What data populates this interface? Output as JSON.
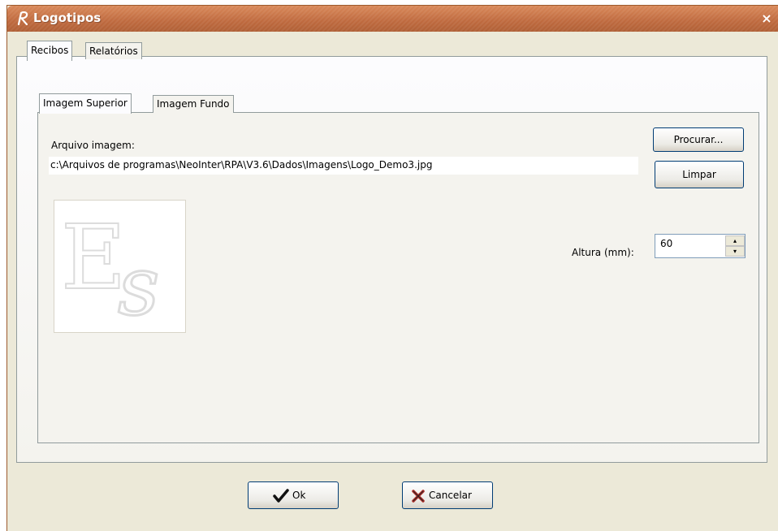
{
  "window": {
    "title": "Logotipos",
    "close_label": "×",
    "app_icon": "r-logo-icon"
  },
  "top_tabs": [
    {
      "label": "Recibos",
      "active": true
    },
    {
      "label": "Relatórios",
      "active": false
    }
  ],
  "inner_tabs": [
    {
      "label": "Imagem Superior",
      "active": true
    },
    {
      "label": "Imagem Fundo",
      "active": false
    }
  ],
  "file": {
    "label": "Arquivo imagem:",
    "path": "c:\\Arquivos de programas\\NeoInter\\RPA\\V3.6\\Dados\\Imagens\\Logo_Demo3.jpg"
  },
  "buttons": {
    "browse": "Procurar...",
    "clear": "Limpar",
    "ok": "Ok",
    "cancel": "Cancelar"
  },
  "height": {
    "label": "Altura (mm):",
    "value": "60"
  },
  "icons": {
    "ok": "checkmark-icon",
    "cancel": "x-cross-icon",
    "spin_up": "arrow-up-icon",
    "spin_down": "arrow-down-icon"
  },
  "colors": {
    "titlebar": "#c0703f",
    "dialog_bg": "#ece9d8",
    "button_border": "#003c74"
  }
}
